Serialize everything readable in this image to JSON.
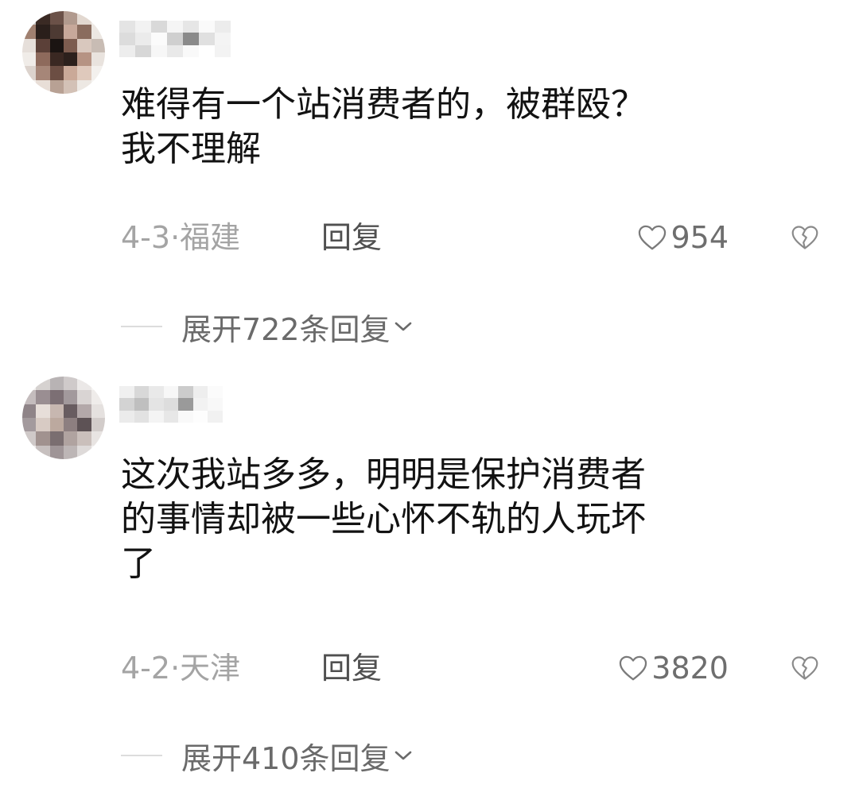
{
  "comments": [
    {
      "text": "难得有一个站消费者的，被群殴？\n我不理解",
      "date_location": "4-3·福建",
      "reply_label": "回复",
      "likes": "954",
      "expand_label": "展开722条回复"
    },
    {
      "text": "这次我站多多，明明是保护消费者\n的事情却被一些心怀不轨的人玩坏\n了",
      "date_location": "4-2·天津",
      "reply_label": "回复",
      "likes": "3820",
      "expand_label": "展开410条回复"
    }
  ],
  "colors": {
    "text": "#121212",
    "meta": "#a4a4a4",
    "reply": "#505050",
    "likes": "#6e6e6e",
    "expand": "#6a6a6a",
    "divider": "#dcdcdc"
  }
}
